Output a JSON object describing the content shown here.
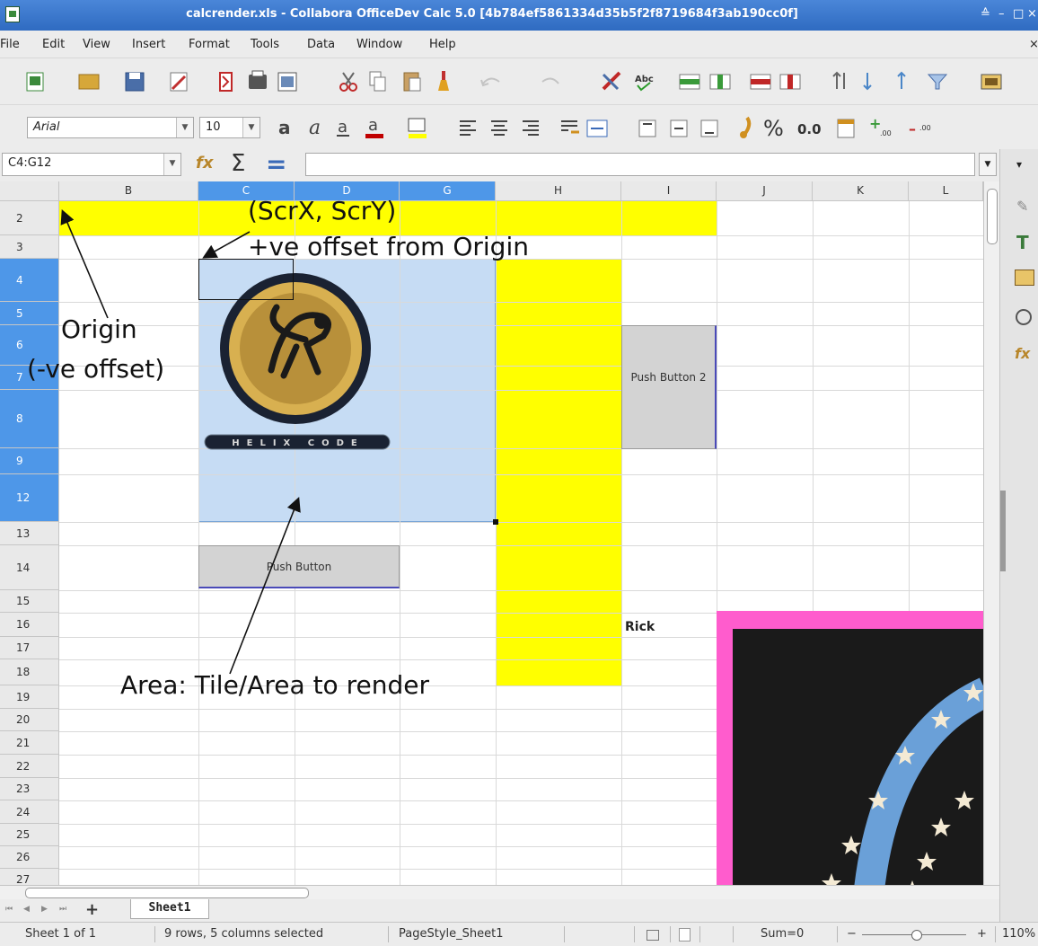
{
  "window": {
    "title": "calcrender.xls - Collabora OfficeDev Calc 5.0 [4b784ef5861334d35b5f2f8719684f3ab190cc0f]",
    "controls": [
      "≙",
      "–",
      "□",
      "×"
    ]
  },
  "menubar": {
    "items": [
      "File",
      "Edit",
      "View",
      "Insert",
      "Format",
      "Tools",
      "Data",
      "Window",
      "Help"
    ],
    "close_glyph": "×"
  },
  "formatting": {
    "font_name": "Arial",
    "font_size": "10",
    "percent_label": "%",
    "decimal_label": "0.0"
  },
  "formula_bar": {
    "name_box": "C4:G12",
    "sigma": "Σ",
    "equals": "=",
    "input": ""
  },
  "sheet": {
    "columns": [
      "B",
      "C",
      "D",
      "G",
      "H",
      "I",
      "J",
      "K",
      "L"
    ],
    "rows": [
      "2",
      "3",
      "4",
      "5",
      "6",
      "7",
      "8",
      "9",
      "12",
      "13",
      "14",
      "15",
      "16",
      "17",
      "18",
      "19",
      "20",
      "21",
      "22",
      "23",
      "24",
      "25",
      "26",
      "27"
    ],
    "cells": {
      "rick": "Rick"
    },
    "logo_text": "HELIX  CODE",
    "push_button": "Push Button",
    "push_button_2": "Push Button 2"
  },
  "annotations": {
    "scr": "(ScrX, ScrY)",
    "offset": "+ve offset from Origin",
    "origin": "Origin",
    "origin_note": "(-ve offset)",
    "area": "Area: Tile/Area to render"
  },
  "tabs": {
    "nav": [
      "⏮",
      "◀",
      "▶",
      "⏭"
    ],
    "add": "+",
    "active": "Sheet1"
  },
  "status": {
    "sheet": "Sheet 1 of 1",
    "selection": "9 rows, 5 columns selected",
    "page_style": "PageStyle_Sheet1",
    "sum": "Sum=0",
    "zoom": "110%"
  },
  "colors": {
    "selection": "#c6dcf4",
    "highlight": "#ffff00",
    "pink": "#ff5ccd",
    "header_selected": "#4e97e8"
  }
}
